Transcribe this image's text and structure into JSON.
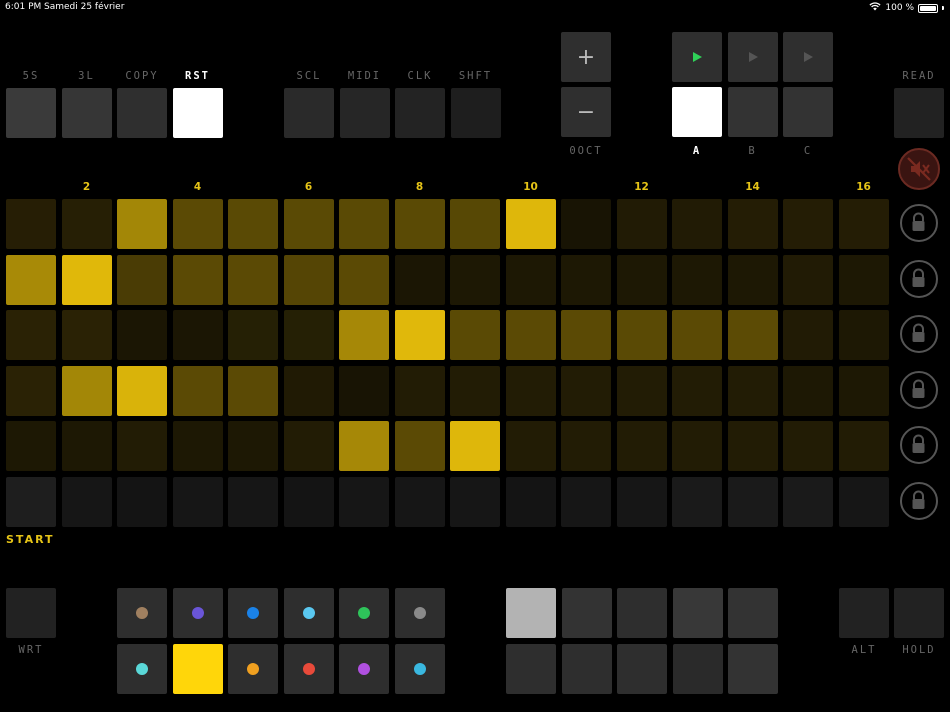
{
  "status_bar": {
    "time": "6:01 PM",
    "date": "Samedi 25 février",
    "battery": "100 %"
  },
  "top_left_buttons": [
    {
      "label": "5S",
      "color": "#3a3a3a",
      "active": false
    },
    {
      "label": "3L",
      "color": "#363636",
      "active": false
    },
    {
      "label": "COPY",
      "color": "#2f2f2f",
      "active": false
    },
    {
      "label": "RST",
      "color": "#ffffff",
      "active": true
    }
  ],
  "top_mid_buttons": [
    {
      "label": "SCL",
      "color": "#2a2a2a"
    },
    {
      "label": "MIDI",
      "color": "#262626"
    },
    {
      "label": "CLK",
      "color": "#232323"
    },
    {
      "label": "SHFT",
      "color": "#1e1e1e"
    }
  ],
  "octave": {
    "plus": "+",
    "minus": "−",
    "label": "0OCT"
  },
  "patterns": [
    {
      "label": "A",
      "active": true
    },
    {
      "label": "B",
      "active": false
    },
    {
      "label": "C",
      "active": false
    }
  ],
  "read_label": "READ",
  "column_numbers": [
    "2",
    "4",
    "6",
    "8",
    "10",
    "12",
    "14",
    "16"
  ],
  "start_label": "START",
  "grid": [
    [
      "#261e05",
      "#261f05",
      "#a38707",
      "#5b4a05",
      "#5a4a05",
      "#5a4a05",
      "#5a4a05",
      "#5a4a05",
      "#574805",
      "#deb70b",
      "#181404",
      "#211b05",
      "#211b05",
      "#241d05",
      "#241d05",
      "#241d05"
    ],
    [
      "#a88a07",
      "#e0b80a",
      "#4a3c05",
      "#5b4a05",
      "#5b4a05",
      "#554505",
      "#5b4a05",
      "#1b1604",
      "#1d1804",
      "#1d1804",
      "#1d1804",
      "#1d1804",
      "#1d1804",
      "#1d1804",
      "#211b05",
      "#1d1804"
    ],
    [
      "#2a2205",
      "#2a2205",
      "#1b1604",
      "#1b1604",
      "#252005",
      "#252005",
      "#a68807",
      "#e0b80b",
      "#5a4a05",
      "#5b4a05",
      "#5b4a05",
      "#5a4a05",
      "#5b4a05",
      "#5c4b05",
      "#211b05",
      "#1d1804"
    ],
    [
      "#2a2205",
      "#a38707",
      "#d9b30a",
      "#5b4a05",
      "#5b4a05",
      "#201a04",
      "#181404",
      "#221c05",
      "#221c05",
      "#221c05",
      "#221c05",
      "#221c05",
      "#221c05",
      "#221c05",
      "#1d1804",
      "#1d1804"
    ],
    [
      "#1d1804",
      "#1d1804",
      "#221c05",
      "#1d1804",
      "#1d1804",
      "#221c05",
      "#a68807",
      "#5b4a05",
      "#deb70b",
      "#221c05",
      "#221c05",
      "#221c05",
      "#221c05",
      "#221c05",
      "#221c05",
      "#221c05"
    ],
    [
      "#1e1e1e",
      "#161616",
      "#141414",
      "#161616",
      "#161616",
      "#141414",
      "#161616",
      "#161616",
      "#161616",
      "#141414",
      "#161616",
      "#161616",
      "#1a1a1a",
      "#1a1a1a",
      "#1a1a1a",
      "#161616"
    ]
  ],
  "bottom": {
    "wrt_label": "WRT",
    "alt_label": "ALT",
    "hold_label": "HOLD",
    "color_row1": [
      "#a08060",
      "#6a55d8",
      "#1a82e8",
      "#5ac8f0",
      "#2ec45a",
      "#8a8a8a"
    ],
    "color_row2": [
      "#5ad8d8",
      "selected",
      "#f0a020",
      "#e84a3a",
      "#b050e0",
      "#3ab8e0"
    ],
    "selected_color": "#ffd60a",
    "gray_row1": [
      "#b3b3b3",
      "#333333",
      "#2e2e2e",
      "#383838",
      "#333333"
    ],
    "gray_row2": [
      "#2e2e2e",
      "#2e2e2e",
      "#2e2e2e",
      "#2a2a2a",
      "#333333"
    ]
  }
}
